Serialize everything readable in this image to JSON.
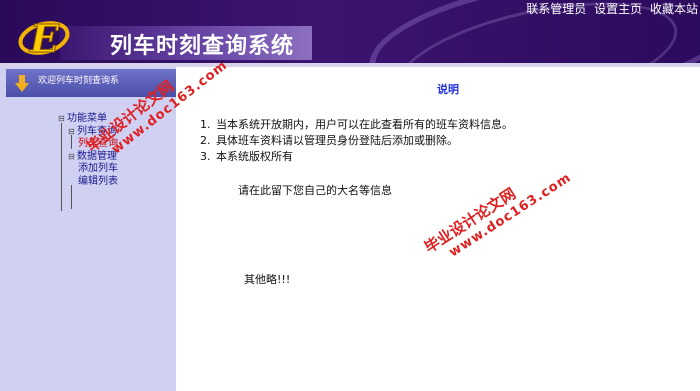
{
  "header": {
    "app_title": "列车时刻查询系统",
    "logo_letter": "E",
    "nav": [
      "联系管理员",
      "设置主页",
      "收藏本站"
    ]
  },
  "sidebar": {
    "welcome": "欢迎列车时刻查询系",
    "tree": {
      "root": "功能菜单",
      "groups": [
        {
          "label": "列车查询",
          "children": [
            "列车查询"
          ]
        },
        {
          "label": "数据管理",
          "children": [
            "添加列车",
            "编辑列表"
          ]
        }
      ]
    }
  },
  "main": {
    "title": "说明",
    "items": [
      "当本系统开放期内，用户可以在此查看所有的班车资料信息。",
      "具体班车资料请以管理员身份登陆后添加或删除。",
      "本系统版权所有"
    ],
    "message": "请在此留下您自己的大名等信息",
    "other": "其他略!!!"
  },
  "watermark": {
    "name": "毕业设计论文网",
    "url": "www.doc163.com"
  },
  "colors": {
    "header_bg": "#2a0a5a",
    "sidebar_bg": "#cfd0f2",
    "title_blue": "#2233dd",
    "watermark_red": "#e02020"
  }
}
